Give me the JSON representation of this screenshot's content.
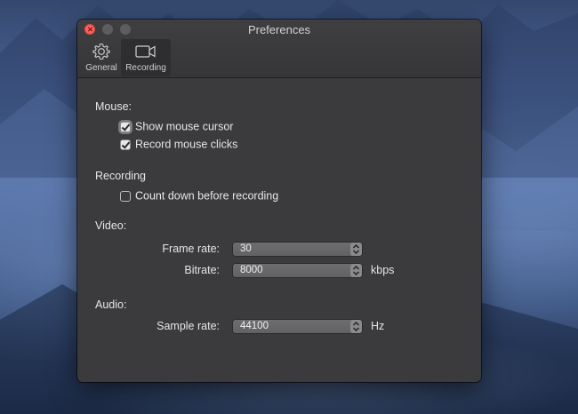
{
  "window": {
    "title": "Preferences"
  },
  "toolbar": {
    "items": [
      {
        "label": "General",
        "icon": "gear-icon",
        "selected": false
      },
      {
        "label": "Recording",
        "icon": "video-camera-icon",
        "selected": true
      }
    ]
  },
  "mouse": {
    "heading": "Mouse:",
    "show_cursor": {
      "label": "Show mouse cursor",
      "checked": true
    },
    "record_clicks": {
      "label": "Record mouse clicks",
      "checked": true
    }
  },
  "recording": {
    "heading": "Recording",
    "countdown": {
      "label": "Count down before recording",
      "checked": false
    }
  },
  "video": {
    "heading": "Video:",
    "frame_rate": {
      "label": "Frame rate:",
      "value": "30"
    },
    "bitrate": {
      "label": "Bitrate:",
      "value": "8000",
      "unit": "kbps"
    }
  },
  "audio": {
    "heading": "Audio:",
    "sample_rate": {
      "label": "Sample rate:",
      "value": "44100",
      "unit": "Hz"
    }
  },
  "colors": {
    "window_bg": "#3b3b3d",
    "close_button": "#fc605c",
    "select_bg": "#666668"
  }
}
